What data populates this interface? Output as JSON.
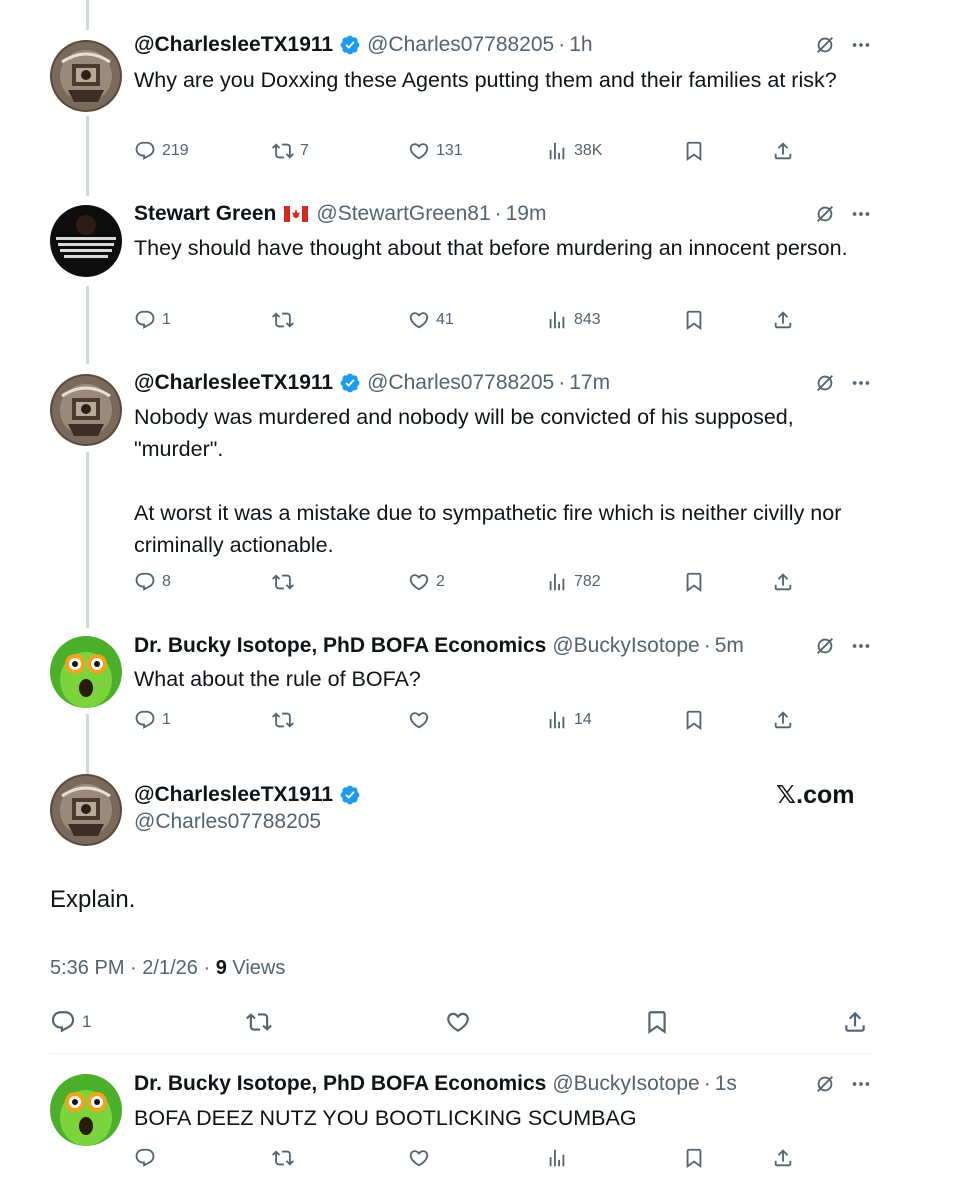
{
  "tweets": [
    {
      "name": "@CharlesleeTX1911",
      "handle": "@Charles07788205",
      "time": "1h",
      "text": "Why are you Doxxing these Agents putting them and their families at risk?",
      "replies": "219",
      "reposts": "7",
      "likes": "131",
      "views": "38K"
    },
    {
      "name": "Stewart Green",
      "handle": "@StewartGreen81",
      "time": "19m",
      "text": "They should have thought about that before murdering an innocent person.",
      "replies": "1",
      "reposts": "",
      "likes": "41",
      "views": "843"
    },
    {
      "name": "@CharlesleeTX1911",
      "handle": "@Charles07788205",
      "time": "17m",
      "text": "Nobody was murdered and nobody will be convicted of his supposed, \"murder\".\n\nAt worst it was a mistake due to sympathetic fire which is neither civilly nor criminally actionable.",
      "replies": "8",
      "reposts": "",
      "likes": "2",
      "views": "782"
    },
    {
      "name": "Dr. Bucky Isotope, PhD BOFA Economics",
      "handle": "@BuckyIsotope",
      "time": "5m",
      "text": "What about the rule of BOFA?",
      "replies": "1",
      "reposts": "",
      "likes": "",
      "views": "14"
    }
  ],
  "main": {
    "name": "@CharlesleeTX1911",
    "handle": "@Charles07788205",
    "watermark": "𝕏.com",
    "text": "Explain.",
    "time": "5:36 PM",
    "date": "2/1/26",
    "views_count": "9",
    "views_label": "Views",
    "replies": "1"
  },
  "reply": {
    "name": "Dr. Bucky Isotope, PhD BOFA Economics",
    "handle": "@BuckyIsotope",
    "time": "1s",
    "text": "BOFA DEEZ NUTZ YOU BOOTLICKING SCUMBAG"
  },
  "separator": "·",
  "icons": {
    "reply": "reply-icon",
    "repost": "repost-icon",
    "like": "heart-icon",
    "views": "views-icon",
    "bookmark": "bookmark-icon",
    "share": "share-icon",
    "grok": "grok-icon",
    "more": "more-icon",
    "verified": "verified-badge-icon",
    "flag": "canada-flag-icon"
  },
  "colors": {
    "text": "#0f1419",
    "secondary": "#536471",
    "verified": "#1d9bf0",
    "line": "#cfd9de"
  }
}
